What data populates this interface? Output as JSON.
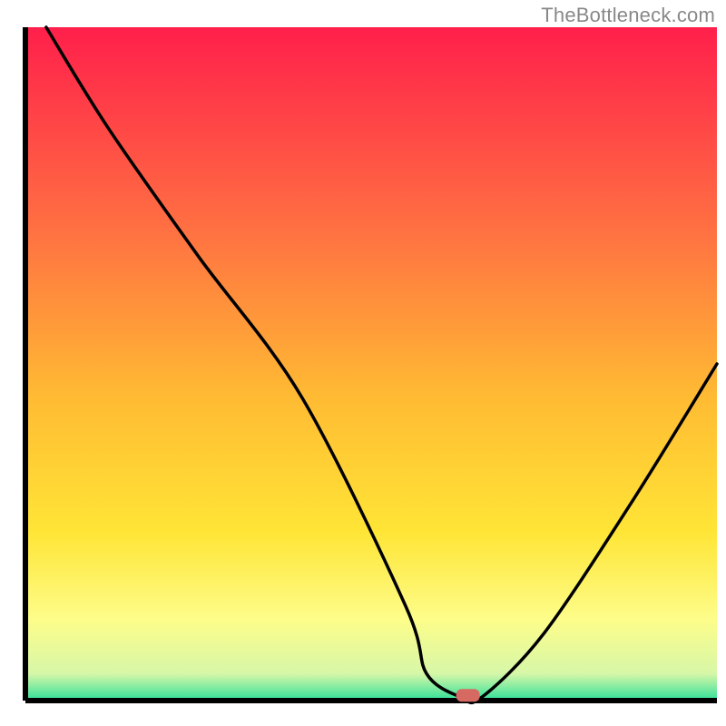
{
  "watermark": "TheBottleneck.com",
  "chart_data": {
    "type": "line",
    "title": "",
    "xlabel": "",
    "ylabel": "",
    "xlim": [
      0,
      100
    ],
    "ylim": [
      0,
      100
    ],
    "x": [
      3,
      12,
      25,
      40,
      55,
      58,
      63,
      66,
      75,
      88,
      100
    ],
    "y": [
      100,
      85,
      66,
      45,
      14,
      4,
      0.5,
      0.5,
      10,
      30,
      50
    ],
    "minimum_marker": {
      "x": 64,
      "y": 0.5
    },
    "background": {
      "gradient_stops": [
        {
          "offset": 0.0,
          "color": "#ff1f4b"
        },
        {
          "offset": 0.3,
          "color": "#ff7042"
        },
        {
          "offset": 0.55,
          "color": "#ffbb33"
        },
        {
          "offset": 0.75,
          "color": "#ffe536"
        },
        {
          "offset": 0.88,
          "color": "#fdfd8a"
        },
        {
          "offset": 0.96,
          "color": "#d7f7a8"
        },
        {
          "offset": 1.0,
          "color": "#2fe09a"
        }
      ]
    },
    "axis_color": "#000000",
    "line_color": "#000000",
    "marker_color": "#d66a63"
  }
}
